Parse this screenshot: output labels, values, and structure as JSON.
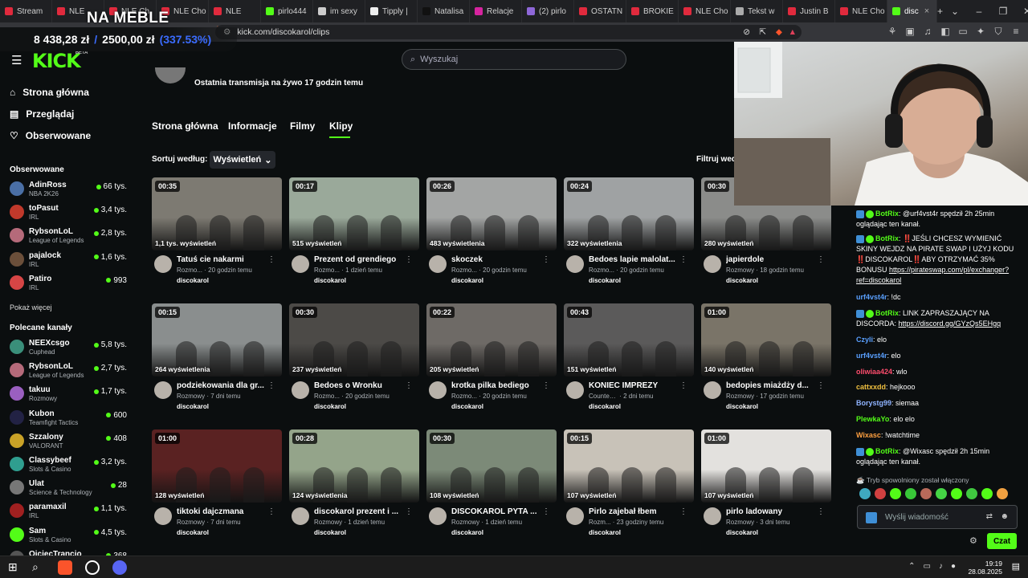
{
  "browser": {
    "tabs": [
      {
        "label": "Stream",
        "color": "#e02a3d"
      },
      {
        "label": "NLE",
        "color": "#e02a3d"
      },
      {
        "label": "NLE Ch",
        "color": "#e02a3d"
      },
      {
        "label": "NLE Cho",
        "color": "#e02a3d"
      },
      {
        "label": "NLE",
        "color": "#e02a3d"
      },
      {
        "label": "pirlo444",
        "color": "#53fc18"
      },
      {
        "label": "im sexy",
        "color": "#cccccc"
      },
      {
        "label": "Tipply |",
        "color": "#eeeeee"
      },
      {
        "label": "Natalisa",
        "color": "#111111"
      },
      {
        "label": "Relacje",
        "color": "#d6249f"
      },
      {
        "label": "(2) pirlo",
        "color": "#8e67d8"
      },
      {
        "label": "OSTATN",
        "color": "#e02a3d"
      },
      {
        "label": "BROKIE",
        "color": "#e02a3d"
      },
      {
        "label": "NLE Cho",
        "color": "#e02a3d"
      },
      {
        "label": "Tekst w",
        "color": "#aaaaaa"
      },
      {
        "label": "Justin B",
        "color": "#e02a3d"
      },
      {
        "label": "NLE Cho",
        "color": "#e02a3d"
      },
      {
        "label": "disc",
        "color": "#53fc18",
        "active": true
      }
    ],
    "url": "kick.com/discokarol/clips"
  },
  "overlay": {
    "title": "NA MEBLE",
    "amount_left": "8 438,28 zł",
    "separator": "/",
    "amount_goal": "2500,00 zł",
    "percent": "(337.53%)"
  },
  "kick": {
    "logo": "KICK",
    "beta": "BETA",
    "search_placeholder": "Wyszukaj"
  },
  "sidebar": {
    "nav": [
      {
        "label": "Strona główna",
        "icon": "home-icon",
        "glyph": "⌂"
      },
      {
        "label": "Przeglądaj",
        "icon": "browse-icon",
        "glyph": "▤"
      },
      {
        "label": "Obserwowane",
        "icon": "heart-icon",
        "glyph": "♡"
      }
    ],
    "followed_header": "Obserwowane",
    "followed": [
      {
        "name": "AdinRoss",
        "category": "NBA 2K26",
        "viewers": "66 tys.",
        "color": "#4a6fa5"
      },
      {
        "name": "toPasut",
        "category": "IRL",
        "viewers": "3,4 tys.",
        "color": "#c0392b"
      },
      {
        "name": "RybsonLoL",
        "category": "League of Legends",
        "viewers": "2,8 tys.",
        "color": "#b56a7a"
      },
      {
        "name": "pajalock",
        "category": "IRL",
        "viewers": "1,6 tys.",
        "color": "#6b4f3a"
      },
      {
        "name": "Patiro",
        "category": "IRL",
        "viewers": "993",
        "color": "#d64545"
      }
    ],
    "show_more": "Pokaż więcej",
    "recommended_header": "Polecane kanały",
    "recommended": [
      {
        "name": "NEEXcsgo",
        "category": "Cuphead",
        "viewers": "5,8 tys.",
        "color": "#3a8f7a"
      },
      {
        "name": "RybsonLoL",
        "category": "League of Legends",
        "viewers": "2,7 tys.",
        "color": "#b56a7a"
      },
      {
        "name": "takuu",
        "category": "Rozmowy",
        "viewers": "1,7 tys.",
        "color": "#9a5fc0"
      },
      {
        "name": "Kubon",
        "category": "Teamfight Tactics",
        "viewers": "600",
        "color": "#222244"
      },
      {
        "name": "Szzalony",
        "category": "VALORANT",
        "viewers": "408",
        "color": "#c9a227"
      },
      {
        "name": "Classybeef",
        "category": "Slots & Casino",
        "viewers": "3,2 tys.",
        "color": "#2f9e8f"
      },
      {
        "name": "Ulat",
        "category": "Science & Technology",
        "viewers": "28",
        "color": "#777777"
      },
      {
        "name": "paramaxil",
        "category": "IRL",
        "viewers": "1,1 tys.",
        "color": "#a02020"
      },
      {
        "name": "Sam",
        "category": "Slots & Casino",
        "viewers": "4,5 tys.",
        "color": "#53fc18"
      },
      {
        "name": "OjciecTrancio",
        "category": "",
        "viewers": "368",
        "color": "#555555"
      }
    ]
  },
  "channel": {
    "last_live": "Ostatnia transmisja na żywo 17 godzin temu",
    "tabs": [
      "Strona główna",
      "Informacje",
      "Filmy",
      "Klipy"
    ],
    "active_tab": "Klipy",
    "sort_label": "Sortuj według:",
    "sort_value": "Wyświetleń",
    "filter_label": "Filtruj wed"
  },
  "clips": [
    {
      "duration": "00:35",
      "views": "1,1 tys. wyświetleń",
      "title": "Tatuś cie nakarmi",
      "category": "Rozmo...",
      "age": "20 godzin temu",
      "author": "discokarol",
      "bg": "#7d7a72"
    },
    {
      "duration": "00:17",
      "views": "515 wyświetleń",
      "title": "Prezent od grendiego",
      "category": "Rozmo...",
      "age": "1 dzień temu",
      "author": "discokarol",
      "bg": "#9aa99a"
    },
    {
      "duration": "00:26",
      "views": "483 wyświetlenia",
      "title": "skoczek",
      "category": "Rozmo...",
      "age": "20 godzin temu",
      "author": "discokarol",
      "bg": "#a3a5a4"
    },
    {
      "duration": "00:24",
      "views": "322 wyświetlenia",
      "title": "Bedoes lapie malolat...",
      "category": "Rozmo...",
      "age": "20 godzin temu",
      "author": "discokarol",
      "bg": "#9fa2a3"
    },
    {
      "duration": "00:30",
      "views": "280 wyświetleń",
      "title": "japierdole",
      "category": "Rozmowy",
      "age": "18 godzin temu",
      "author": "discokarol",
      "bg": "#8b8c8a"
    },
    {
      "duration": "00:15",
      "views": "264 wyświetlenia",
      "title": "podziekowania dla gr...",
      "category": "Rozmowy",
      "age": "7 dni temu",
      "author": "discokarol",
      "bg": "#8a8e8e"
    },
    {
      "duration": "00:30",
      "views": "237 wyświetleń",
      "title": "Bedoes o Wronku",
      "category": "Rozmo...",
      "age": "20 godzin temu",
      "author": "discokarol",
      "bg": "#4c4a47"
    },
    {
      "duration": "00:22",
      "views": "205 wyświetleń",
      "title": "krotka pilka bediego",
      "category": "Rozmo...",
      "age": "20 godzin temu",
      "author": "discokarol",
      "bg": "#6e6a66"
    },
    {
      "duration": "00:43",
      "views": "151 wyświetleń",
      "title": "KONIEC IMPREZY",
      "category": "Counter-Stri...",
      "age": "2 dni temu",
      "author": "discokarol",
      "bg": "#5b5a5a"
    },
    {
      "duration": "01:00",
      "views": "140 wyświetleń",
      "title": "bedopies miażdży d...",
      "category": "Rozmowy",
      "age": "17 godzin temu",
      "author": "discokarol",
      "bg": "#7a7468"
    },
    {
      "duration": "01:00",
      "views": "128 wyświetleń",
      "title": "tiktoki dajczmana",
      "category": "Rozmowy",
      "age": "7 dni temu",
      "author": "discokarol",
      "bg": "#5a2222"
    },
    {
      "duration": "00:28",
      "views": "124 wyświetlenia",
      "title": "discokarol prezent i ...",
      "category": "Rozmowy",
      "age": "1 dzień temu",
      "author": "discokarol",
      "bg": "#94a48a"
    },
    {
      "duration": "00:30",
      "views": "108 wyświetleń",
      "title": "DISCOKAROL PYTA ...",
      "category": "Rozmowy",
      "age": "1 dzień temu",
      "author": "discokarol",
      "bg": "#7c8a78"
    },
    {
      "duration": "00:15",
      "views": "107 wyświetleń",
      "title": "Pirlo zajebał łbem",
      "category": "Rozm...",
      "age": "23 godziny temu",
      "author": "discokarol",
      "bg": "#c8c2b8"
    },
    {
      "duration": "01:00",
      "views": "107 wyświetleń",
      "title": "pirlo ladowany",
      "category": "Rozmowy",
      "age": "3 dni temu",
      "author": "discokarol",
      "bg": "#e3e1de"
    }
  ],
  "chat": {
    "messages": [
      {
        "user": "BotRix",
        "color": "#53fc18",
        "bot": true,
        "text": ": @urf4vst4r spędził 2h 25min oglądając ten kanał.",
        "link": ""
      },
      {
        "user": "BotRix",
        "color": "#53fc18",
        "bot": true,
        "text": ": ‼️JEŚLI CHCESZ WYMIENIĆ SKINY WEJDZ NA PIRATE SWAP I UŻYJ KODU ‼️DISCOKAROL‼️ABY OTRZYMAĆ 35% BONUSU ",
        "link": "https://pirateswap.com/pl/exchanger?ref=discokarol"
      },
      {
        "user": "urf4vst4r",
        "color": "#5aa0ff",
        "bot": false,
        "text": ": !dc",
        "link": ""
      },
      {
        "user": "BotRix",
        "color": "#53fc18",
        "bot": true,
        "text": ": LINK ZAPRASZAJĄCY NA DISCORDA: ",
        "link": "https://discord.gg/GYzQs5EHgq"
      },
      {
        "user": "Czyli",
        "color": "#5aa0ff",
        "bot": false,
        "text": ": elo",
        "link": ""
      },
      {
        "user": "urf4vst4r",
        "color": "#5aa0ff",
        "bot": false,
        "text": ": elo",
        "link": ""
      },
      {
        "user": "oliwiaa424",
        "color": "#ff4d6d",
        "bot": false,
        "text": ": wlo",
        "link": ""
      },
      {
        "user": "cattxxdd",
        "color": "#f0c040",
        "bot": false,
        "text": ": hejkooo",
        "link": ""
      },
      {
        "user": "Borystg99",
        "color": "#8fb3ff",
        "bot": false,
        "text": ": siemaa",
        "link": ""
      },
      {
        "user": "PlewkaYo",
        "color": "#53fc18",
        "bot": false,
        "text": ": elo elo",
        "link": ""
      },
      {
        "user": "Wixasc",
        "color": "#ffa040",
        "bot": false,
        "text": ": !watchtime",
        "link": ""
      },
      {
        "user": "BotRix",
        "color": "#53fc18",
        "bot": true,
        "text": ": @Wixasc spędził 2h 15min oglądając ten kanał.",
        "link": ""
      }
    ],
    "slow_mode": "Tryb spowolniony został włączony",
    "input_placeholder": "Wyślij wiadomość",
    "send_label": "Czat"
  },
  "taskbar": {
    "time": "19:19",
    "date": "28.08.2025"
  }
}
